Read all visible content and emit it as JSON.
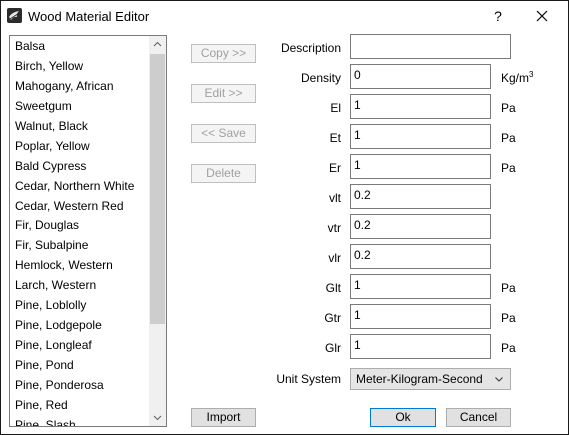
{
  "window": {
    "title": "Wood Material Editor",
    "help_label": "?"
  },
  "species_list": [
    "Balsa",
    "Birch, Yellow",
    "Mahogany, African",
    "Sweetgum",
    "Walnut, Black",
    "Poplar, Yellow",
    "Bald Cypress",
    "Cedar, Northern White",
    "Cedar, Western Red",
    "Fir, Douglas",
    "Fir, Subalpine",
    "Hemlock, Western",
    "Larch, Western",
    "Pine, Loblolly",
    "Pine, Lodgepole",
    "Pine, Longleaf",
    "Pine, Pond",
    "Pine, Ponderosa",
    "Pine, Red",
    "Pine, Slash"
  ],
  "buttons": {
    "copy": "Copy >>",
    "edit": "Edit >>",
    "save": "<< Save",
    "delete": "Delete",
    "import": "Import",
    "ok": "Ok",
    "cancel": "Cancel"
  },
  "properties": {
    "description": {
      "label": "Description",
      "value": "",
      "unit": ""
    },
    "density": {
      "label": "Density",
      "value": "0",
      "unit": "Kg/m",
      "unit_sup": "3"
    },
    "el": {
      "label": "El",
      "value": "1",
      "unit": "Pa"
    },
    "et": {
      "label": "Et",
      "value": "1",
      "unit": "Pa"
    },
    "er": {
      "label": "Er",
      "value": "1",
      "unit": "Pa"
    },
    "vlt": {
      "label": "vlt",
      "value": "0.2"
    },
    "vtr": {
      "label": "vtr",
      "value": "0.2"
    },
    "vlr": {
      "label": "vlr",
      "value": "0.2"
    },
    "glt": {
      "label": "Glt",
      "value": "1",
      "unit": "Pa"
    },
    "gtr": {
      "label": "Gtr",
      "value": "1",
      "unit": "Pa"
    },
    "glr": {
      "label": "Glr",
      "value": "1",
      "unit": "Pa"
    }
  },
  "unit_system": {
    "label": "Unit System",
    "selected": "Meter-Kilogram-Second"
  },
  "icons": {
    "app": "wood-material-app-icon",
    "help": "help-icon",
    "close": "close-icon",
    "scroll_up": "chevron-up-icon",
    "scroll_down": "chevron-down-icon",
    "dropdown": "chevron-down-icon"
  },
  "colors": {
    "disabled_text": "#a0a0a0",
    "default_button_border": "#0078d7",
    "scroll_thumb": "#cdcdcd"
  }
}
